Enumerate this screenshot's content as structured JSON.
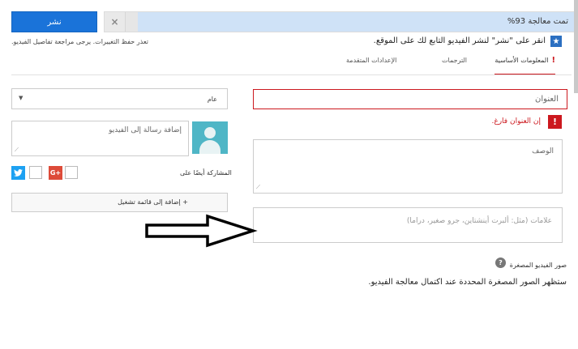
{
  "upload": {
    "progress_text": "تمت معالجة 93%",
    "progress_percent": 93,
    "close_symbol": "×",
    "publish_label": "نشر"
  },
  "info": {
    "icon": "star-icon",
    "text": "انقر على \"نشر\" لنشر الفيديو التابع لك على الموقع.",
    "warning": "تعذر حفظ التغييرات. يرجى مراجعة تفاصيل الفيديو."
  },
  "tabs": [
    {
      "label": "المعلومات الأساسية",
      "alert": "!",
      "active": true
    },
    {
      "label": "الترجمات",
      "active": false
    },
    {
      "label": "الإعدادات المتقدمة",
      "active": false
    }
  ],
  "privacy": {
    "selected": "عام",
    "arrow": "▼"
  },
  "message": {
    "placeholder": "إضافة رسالة إلى الفيديو"
  },
  "share": {
    "label": "المشاركة أيضًا على",
    "twitter_icon": "twitter-icon",
    "gplus_label": "G+"
  },
  "playlist": {
    "label": "+ إضافة إلى قائمة تشغيل"
  },
  "title": {
    "placeholder": "العنوان",
    "error_icon": "!",
    "error": "إن العنوان فارغ."
  },
  "description": {
    "placeholder": "الوصف"
  },
  "tags": {
    "placeholder": "علامات (مثل: ألبرت أينشتاين، جرو صغير، دراما)"
  },
  "thumbnails": {
    "title": "صور الفيديو المصغرة",
    "help": "?",
    "note": "ستظهر الصور المصغرة المحددة عند اكتمال معالجة الفيديو."
  },
  "colors": {
    "accent": "#1a73d9",
    "error": "#cc181e",
    "progress": "#cfe2f7"
  }
}
